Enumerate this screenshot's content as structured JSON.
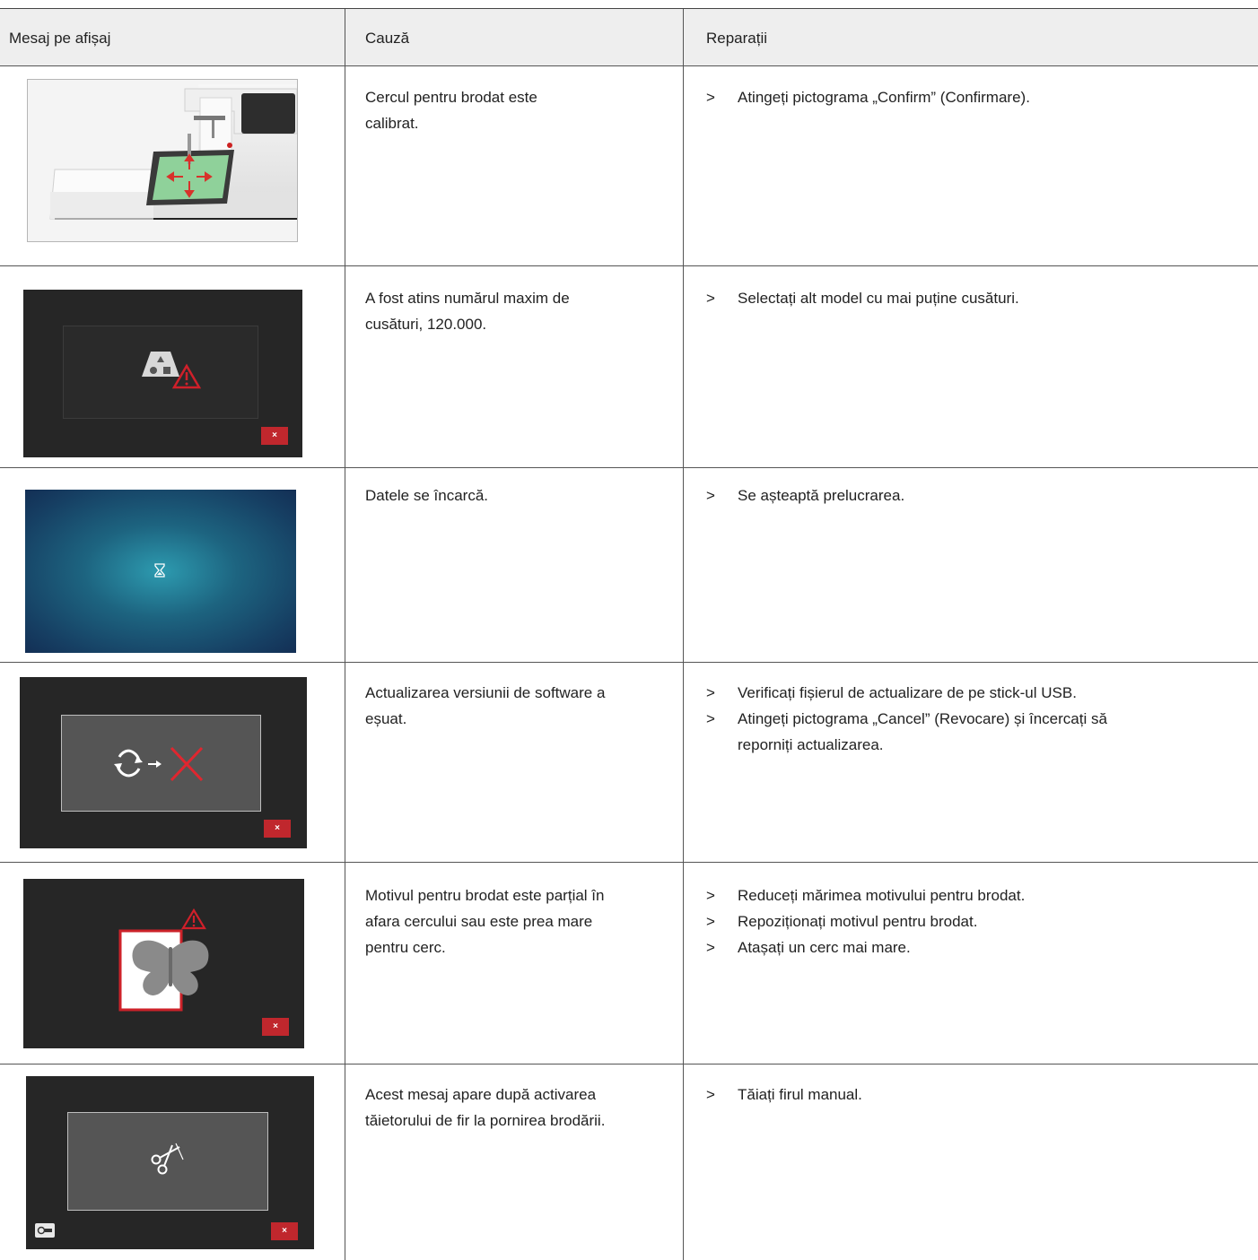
{
  "header": {
    "col1": "Mesaj pe afișaj",
    "col2": "Cauză",
    "col3": "Reparații"
  },
  "rows": [
    {
      "image_icon": "embroidery-machine-calibration-icon",
      "cause": [
        "Cercul pentru brodat este",
        "calibrat."
      ],
      "remedies": [
        "Atingeți pictograma „Confirm” (Confirmare)."
      ]
    },
    {
      "image_icon": "max-stitches-warning-icon",
      "button_label": "×",
      "cause": [
        "A fost atins numărul maxim de",
        "cusături, 120.000."
      ],
      "remedies": [
        "Selectați alt model cu mai puține cusături."
      ]
    },
    {
      "image_icon": "hourglass-icon",
      "cause": [
        "Datele se încarcă."
      ],
      "remedies": [
        "Se așteaptă prelucrarea."
      ]
    },
    {
      "image_icon": "update-failed-icon",
      "button_label": "×",
      "cause": [
        "Actualizarea versiunii de software a",
        "eșuat."
      ],
      "remedies": [
        "Verificați fișierul de actualizare de pe stick-ul USB.",
        "Atingeți pictograma „Cancel” (Revocare) și încercați să reporniți actualizarea."
      ]
    },
    {
      "image_icon": "butterfly-outside-hoop-icon",
      "button_label": "×",
      "cause": [
        "Motivul pentru brodat este parțial în",
        "afara cercului sau este prea mare",
        "pentru cerc."
      ],
      "remedies": [
        "Reduceți mărimea motivului pentru brodat.",
        "Repoziționați motivul pentru brodat.",
        "Atașați un cerc mai mare."
      ]
    },
    {
      "image_icon": "scissors-thread-cut-icon",
      "button_label": "×",
      "cause": [
        "Acest mesaj apare după activarea",
        "tăietorului de fir la pornirea brodării."
      ],
      "remedies": [
        "Tăiați firul manual."
      ]
    }
  ],
  "remedy_marker": ">",
  "colors": {
    "header_bg": "#eeeeee",
    "screen_dark": "#262626",
    "close_red": "#c0272d",
    "warning_red": "#d0202a"
  }
}
